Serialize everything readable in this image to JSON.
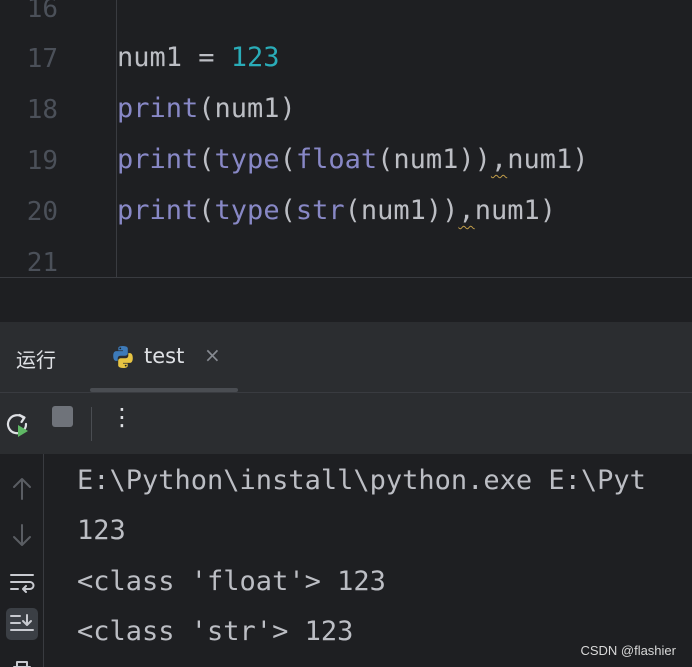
{
  "editor": {
    "line_numbers": [
      "16",
      "17",
      "18",
      "19",
      "20",
      "21"
    ],
    "lines": [
      {
        "segments": []
      },
      {
        "segments": [
          {
            "text": "num1 = ",
            "cls": ""
          },
          {
            "text": "123",
            "cls": "num"
          }
        ]
      },
      {
        "segments": [
          {
            "text": "print",
            "cls": "kw"
          },
          {
            "text": "(num1)",
            "cls": ""
          }
        ]
      },
      {
        "segments": [
          {
            "text": "print",
            "cls": "kw"
          },
          {
            "text": "(",
            "cls": ""
          },
          {
            "text": "type",
            "cls": "kw"
          },
          {
            "text": "(",
            "cls": ""
          },
          {
            "text": "float",
            "cls": "kw"
          },
          {
            "text": "(num1))",
            "cls": ""
          },
          {
            "text": ",",
            "cls": "squig"
          },
          {
            "text": "num1)",
            "cls": ""
          }
        ]
      },
      {
        "segments": [
          {
            "text": "print",
            "cls": "kw"
          },
          {
            "text": "(",
            "cls": ""
          },
          {
            "text": "type",
            "cls": "kw"
          },
          {
            "text": "(",
            "cls": ""
          },
          {
            "text": "str",
            "cls": "kw"
          },
          {
            "text": "(num1))",
            "cls": ""
          },
          {
            "text": ",",
            "cls": "squig"
          },
          {
            "text": "num1)",
            "cls": ""
          }
        ]
      },
      {
        "segments": []
      }
    ]
  },
  "run_window": {
    "title": "运行",
    "tab": {
      "label": "test",
      "icon": "python-icon",
      "close": "×"
    },
    "toolbar": {
      "rerun_icon": "rerun-icon",
      "stop_icon": "stop-icon",
      "more_label": "⋮"
    },
    "console_icons": [
      "scroll-up-icon",
      "scroll-down-icon",
      "soft-wrap-icon",
      "scroll-to-end-icon",
      "print-icon"
    ],
    "output": [
      "E:\\Python\\install\\python.exe E:\\Pyt",
      "123",
      "<class 'float'> 123",
      "<class 'str'> 123"
    ]
  },
  "watermark": "CSDN @flashier",
  "colors": {
    "background": "#1e1f22",
    "panel": "#2b2d30",
    "keyword": "#8888c6",
    "number": "#2aacb8",
    "text": "#bcbec4"
  }
}
